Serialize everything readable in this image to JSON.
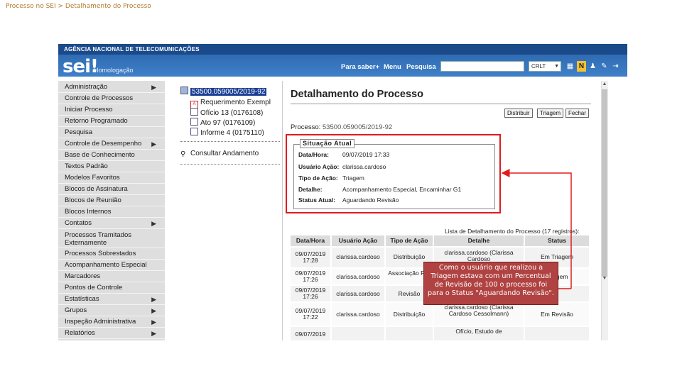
{
  "slide": {
    "title": "Processo no SEI > Detalhamento do Processo"
  },
  "header": {
    "agency": "AGÊNCIA NACIONAL DE TELECOMUNICAÇÕES",
    "logo": "sei!",
    "environment": "Homologação",
    "nav": [
      "Para saber+",
      "Menu",
      "Pesquisa"
    ],
    "search": {
      "value": ""
    },
    "unit": "CRLT"
  },
  "menu": {
    "items": [
      {
        "label": "Administração",
        "submenu": true
      },
      {
        "label": "Controle de Processos",
        "submenu": false
      },
      {
        "label": "Iniciar Processo",
        "submenu": false
      },
      {
        "label": "Retorno Programado",
        "submenu": false
      },
      {
        "label": "Pesquisa",
        "submenu": false
      },
      {
        "label": "Controle de Desempenho",
        "submenu": true
      },
      {
        "label": "Base de Conhecimento",
        "submenu": false
      },
      {
        "label": "Textos Padrão",
        "submenu": false
      },
      {
        "label": "Modelos Favoritos",
        "submenu": false
      },
      {
        "label": "Blocos de Assinatura",
        "submenu": false
      },
      {
        "label": "Blocos de Reunião",
        "submenu": false
      },
      {
        "label": "Blocos Internos",
        "submenu": false
      },
      {
        "label": "Contatos",
        "submenu": true
      },
      {
        "label": "Processos Tramitados Externamente",
        "submenu": false
      },
      {
        "label": "Processos Sobrestados",
        "submenu": false
      },
      {
        "label": "Acompanhamento Especial",
        "submenu": false
      },
      {
        "label": "Marcadores",
        "submenu": false
      },
      {
        "label": "Pontos de Controle",
        "submenu": false
      },
      {
        "label": "Estatísticas",
        "submenu": true
      },
      {
        "label": "Grupos",
        "submenu": true
      },
      {
        "label": "Inspeção Administrativa",
        "submenu": true
      },
      {
        "label": "Relatórios",
        "submenu": true
      }
    ]
  },
  "tree": {
    "root": "53500.059005/2019-92",
    "docs": [
      {
        "label": "Requerimento Exempl",
        "icon": "pdf-icon"
      },
      {
        "label": "Ofício 13 (0176108)",
        "icon": "document-icon"
      },
      {
        "label": "Ato 97 (0176109)",
        "icon": "document-icon"
      },
      {
        "label": "Informe 4 (0175110)",
        "icon": "document-icon"
      }
    ],
    "consult": "Consultar Andamento"
  },
  "main": {
    "title": "Detalhamento do Processo",
    "buttons": [
      "Distribuir",
      "Triagem",
      "Fechar"
    ],
    "process_label": "Processo:",
    "process_number": "53500.059005/2019-92",
    "status_box": {
      "legend": "Situação Atual",
      "rows": [
        {
          "key": "Data/Hora:",
          "value": "09/07/2019 17:33"
        },
        {
          "key": "Usuário Ação:",
          "value": "clarissa.cardoso"
        },
        {
          "key": "Tipo de Ação:",
          "value": "Triagem"
        },
        {
          "key": "Detalhe:",
          "value": "Acompanhamento Especial, Encaminhar G1"
        },
        {
          "key": "Status Atual:",
          "value": "Aguardando Revisão"
        }
      ]
    },
    "history": {
      "caption": "Lista de Detalhamento do Processo (17 registros):",
      "headers": [
        "Data/Hora",
        "Usuário Ação",
        "Tipo de Ação",
        "Detalhe",
        "Status"
      ],
      "rows": [
        [
          "09/07/2019 17:28",
          "clarissa.cardoso",
          "Distribuição",
          "clarissa.cardoso (Clarissa Cardoso",
          "Em Triagem"
        ],
        [
          "09/07/2019 17:26",
          "clarissa.cardoso",
          "Associação Fila",
          "",
          "Triagem"
        ],
        [
          "09/07/2019 17:26",
          "clarissa.cardoso",
          "Revisão",
          "",
          ""
        ],
        [
          "09/07/2019 17:22",
          "clarissa.cardoso",
          "Distribuição",
          "clarissa.cardoso (Clarissa Cardoso Cessolmann)",
          "Em Revisão"
        ],
        [
          "09/07/2019",
          "",
          "",
          "Ofício, Estudo de",
          ""
        ]
      ]
    }
  },
  "callout": {
    "lines": [
      "Como o usuário que realizou a",
      "Triagem estava com um Percentual",
      "de Revisão de 100 o processo foi",
      "para o Status \"Aguardando Revisão\"."
    ]
  },
  "colors": {
    "header_blue": "#2f6bb3",
    "highlight_red": "#e01b1b",
    "callout_bg": "#b04242"
  }
}
